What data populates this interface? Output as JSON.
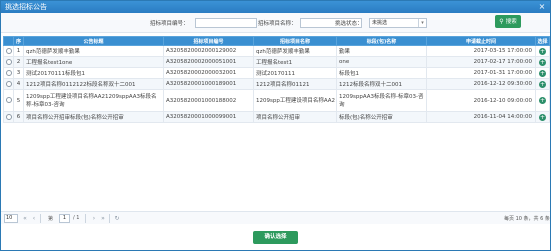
{
  "window": {
    "title": "挑选招标公告",
    "close_glyph": "×"
  },
  "filters": {
    "project_code_label": "招标项目编号：",
    "project_code_value": "",
    "project_name_label": "招标项目名称：",
    "project_name_value": "",
    "status_label": "挑选状态：",
    "status_value": "未挑选",
    "search_label": "搜索"
  },
  "table": {
    "headers": [
      "序",
      "公告标题",
      "招标项目编号",
      "招标项目名称",
      "标段(包)名称",
      "申请截止时间",
      "选择"
    ],
    "rows": [
      {
        "index": "1",
        "title": "qzh范德萨发顺丰勤果",
        "code": "A3205820002000129002",
        "name": "qzh范德萨发顺丰勤果",
        "section": "勤果",
        "deadline": "2017-03-15 17:00:00"
      },
      {
        "index": "2",
        "title": "工程报名test1one",
        "code": "A3205820002000051001",
        "name": "工程报名test1",
        "section": "one",
        "deadline": "2017-02-17 17:00:00"
      },
      {
        "index": "3",
        "title": "测试20170111标段包1",
        "code": "A3205820002000032001",
        "name": "测试20170111",
        "section": "标段包1",
        "deadline": "2017-01-31 17:00:00"
      },
      {
        "index": "4",
        "title": "1212项目名称0112122标段名称双十二001",
        "code": "A3205820001000189001",
        "name": "1212项目名称01121",
        "section": "1212标段名称双十二001",
        "deadline": "2016-12-12 09:30:00"
      },
      {
        "index": "5",
        "title": "1209spp工程建设项目名称AA21209sppAA3标段名称-标章03-咨询",
        "code": "A3205820001000188002",
        "name": "1209spp工程建设项目名称AA2",
        "section": "1209sppAA3标段名称-标章03-咨询",
        "deadline": "2016-12-10 09:00:00"
      },
      {
        "index": "6",
        "title": "项目名称公开招审标段(包)名称公开招审",
        "code": "A3205820001000099001",
        "name": "项目名称公开招审",
        "section": "标段(包)名称公开招审",
        "deadline": "2016-11-04 14:00:00"
      }
    ]
  },
  "pager": {
    "page_size": "10",
    "page_label": "第",
    "current_page": "1",
    "total_pages_label": "/ 1",
    "summary": "每页 10 条，共 6 条"
  },
  "footer": {
    "confirm_label": "确认选择"
  },
  "icons": {
    "search": "search-icon",
    "close": "close-icon",
    "add": "add-icon",
    "refresh": "refresh-icon"
  },
  "colors": {
    "title_bar": "#2a7cc2",
    "header_row": "#3a8fd1",
    "button_green": "#2d9a5d"
  }
}
